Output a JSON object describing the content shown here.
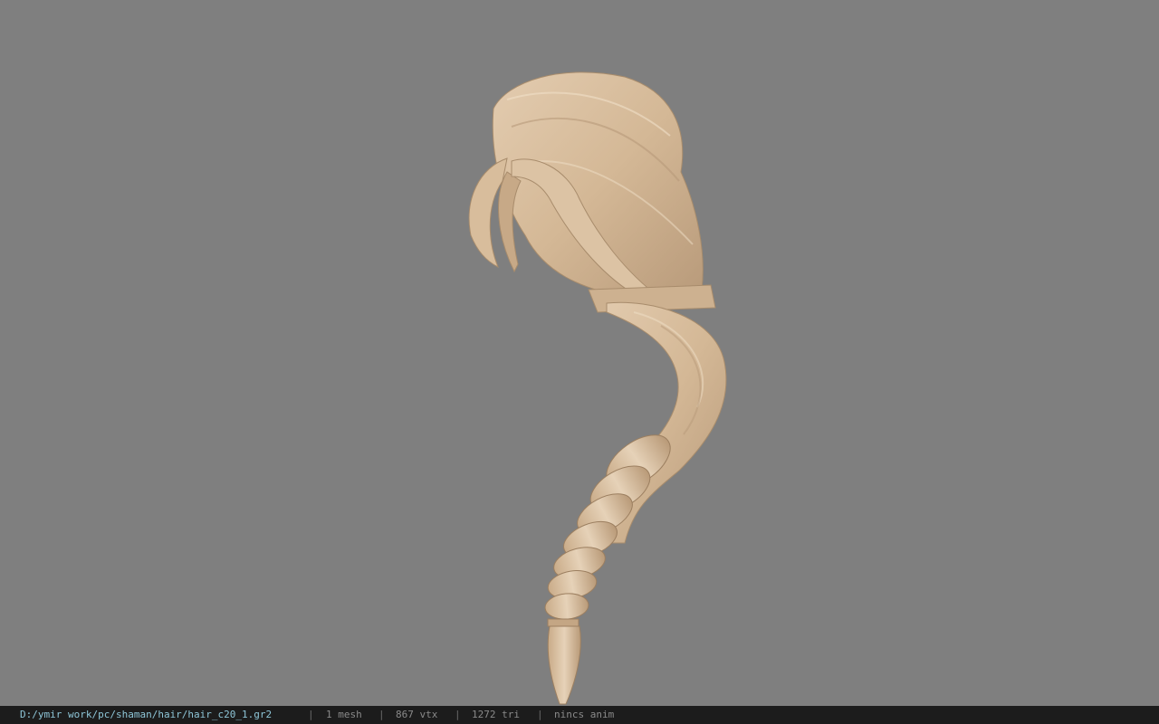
{
  "viewer": {
    "background_color": "#7f7f7f",
    "model": "hair mesh",
    "hair_color": "#d9bfa0"
  },
  "statusbar": {
    "path": "D:/ymir work/pc/shaman/hair/hair_c20_1.gr2",
    "separator": "|",
    "mesh": "1 mesh",
    "vertices": "867 vtx",
    "triangles": "1272 tri",
    "anim": "nincs anim"
  }
}
